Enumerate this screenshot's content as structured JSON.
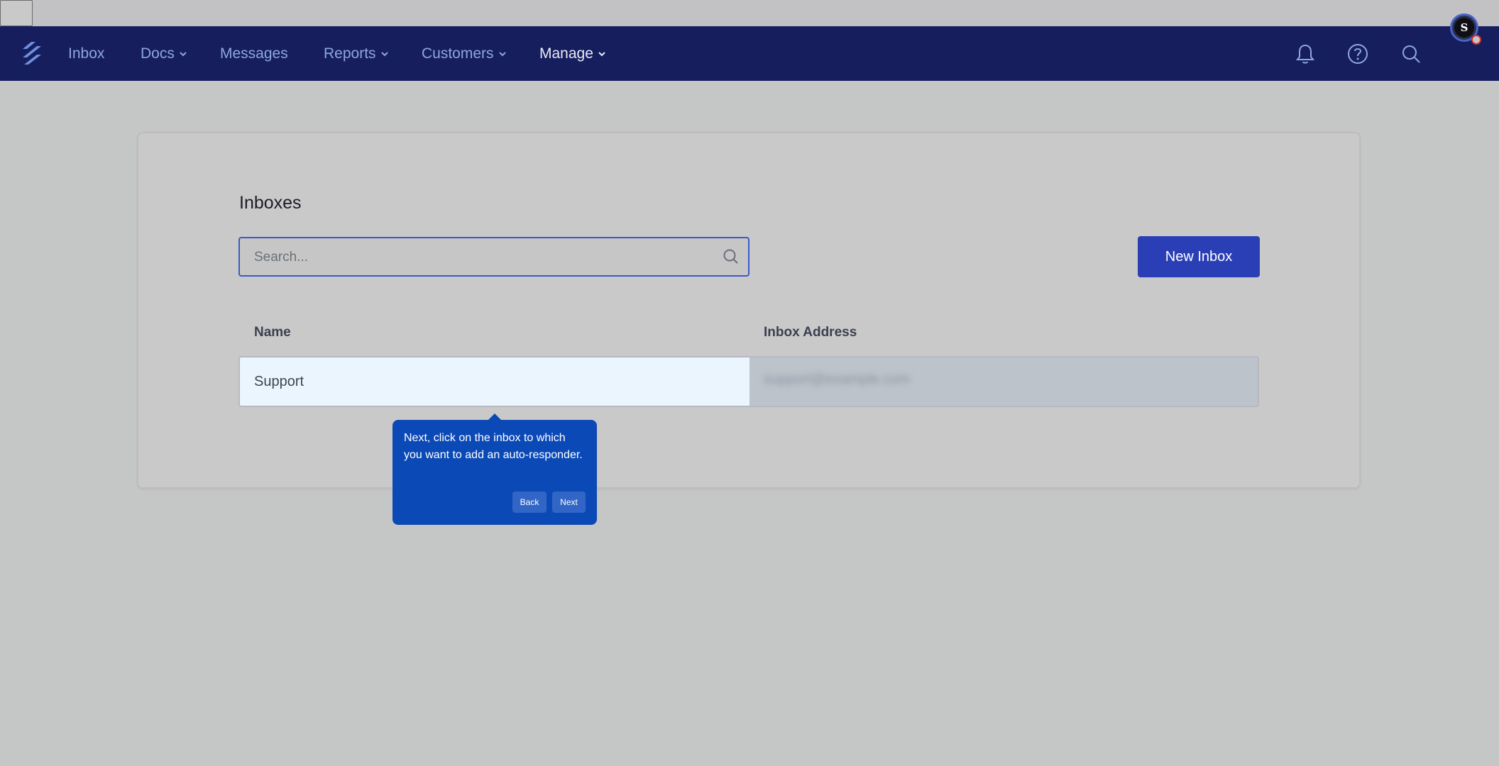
{
  "nav": {
    "items": [
      {
        "label": "Inbox",
        "has_dropdown": false
      },
      {
        "label": "Docs",
        "has_dropdown": true
      },
      {
        "label": "Messages",
        "has_dropdown": false
      },
      {
        "label": "Reports",
        "has_dropdown": true
      },
      {
        "label": "Customers",
        "has_dropdown": true
      },
      {
        "label": "Manage",
        "has_dropdown": true,
        "active": true
      }
    ],
    "right_icons": [
      "bell-icon",
      "help-icon",
      "search-icon"
    ],
    "avatar_initial": "S",
    "colors": {
      "background": "#161e5e",
      "item": "#8ea6e3",
      "active_item": "#e7ebf7"
    }
  },
  "page": {
    "title": "Inboxes",
    "search": {
      "placeholder": "Search...",
      "value": ""
    },
    "new_button_label": "New Inbox",
    "table": {
      "columns": [
        "Name",
        "Inbox Address"
      ],
      "rows": [
        {
          "name": "Support",
          "address": "support@example.com"
        }
      ]
    }
  },
  "tooltip": {
    "text": "Next, click on the inbox to which you want to add an auto-responder.",
    "back_label": "Back",
    "next_label": "Next",
    "color": "#0b49b7"
  },
  "accent": "#2a3fb6"
}
